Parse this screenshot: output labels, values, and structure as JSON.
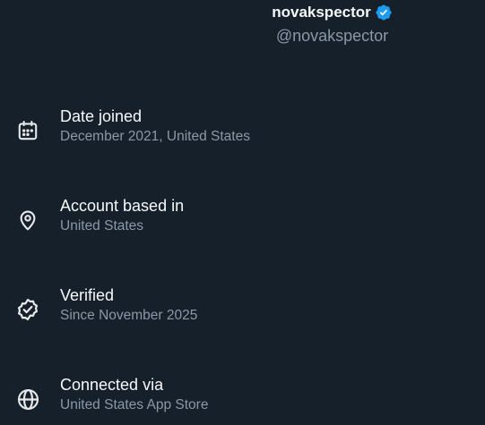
{
  "profile": {
    "display_name": "novakspector",
    "handle": "@novakspector",
    "verified_badge_icon": "verified-badge-icon",
    "badge_color": "#1d9bf0"
  },
  "about": {
    "items": [
      {
        "icon": "calendar-icon",
        "title": "Date joined",
        "subtitle": "December 2021, United States"
      },
      {
        "icon": "location-pin-icon",
        "title": "Account based in",
        "subtitle": "United States"
      },
      {
        "icon": "verified-check-icon",
        "title": "Verified",
        "subtitle": "Since November 2025"
      },
      {
        "icon": "globe-icon",
        "title": "Connected via",
        "subtitle": "United States App Store"
      }
    ]
  },
  "colors": {
    "background": "#16202b",
    "primary_text": "#f7f9f9",
    "secondary_text": "#8b98a5"
  }
}
